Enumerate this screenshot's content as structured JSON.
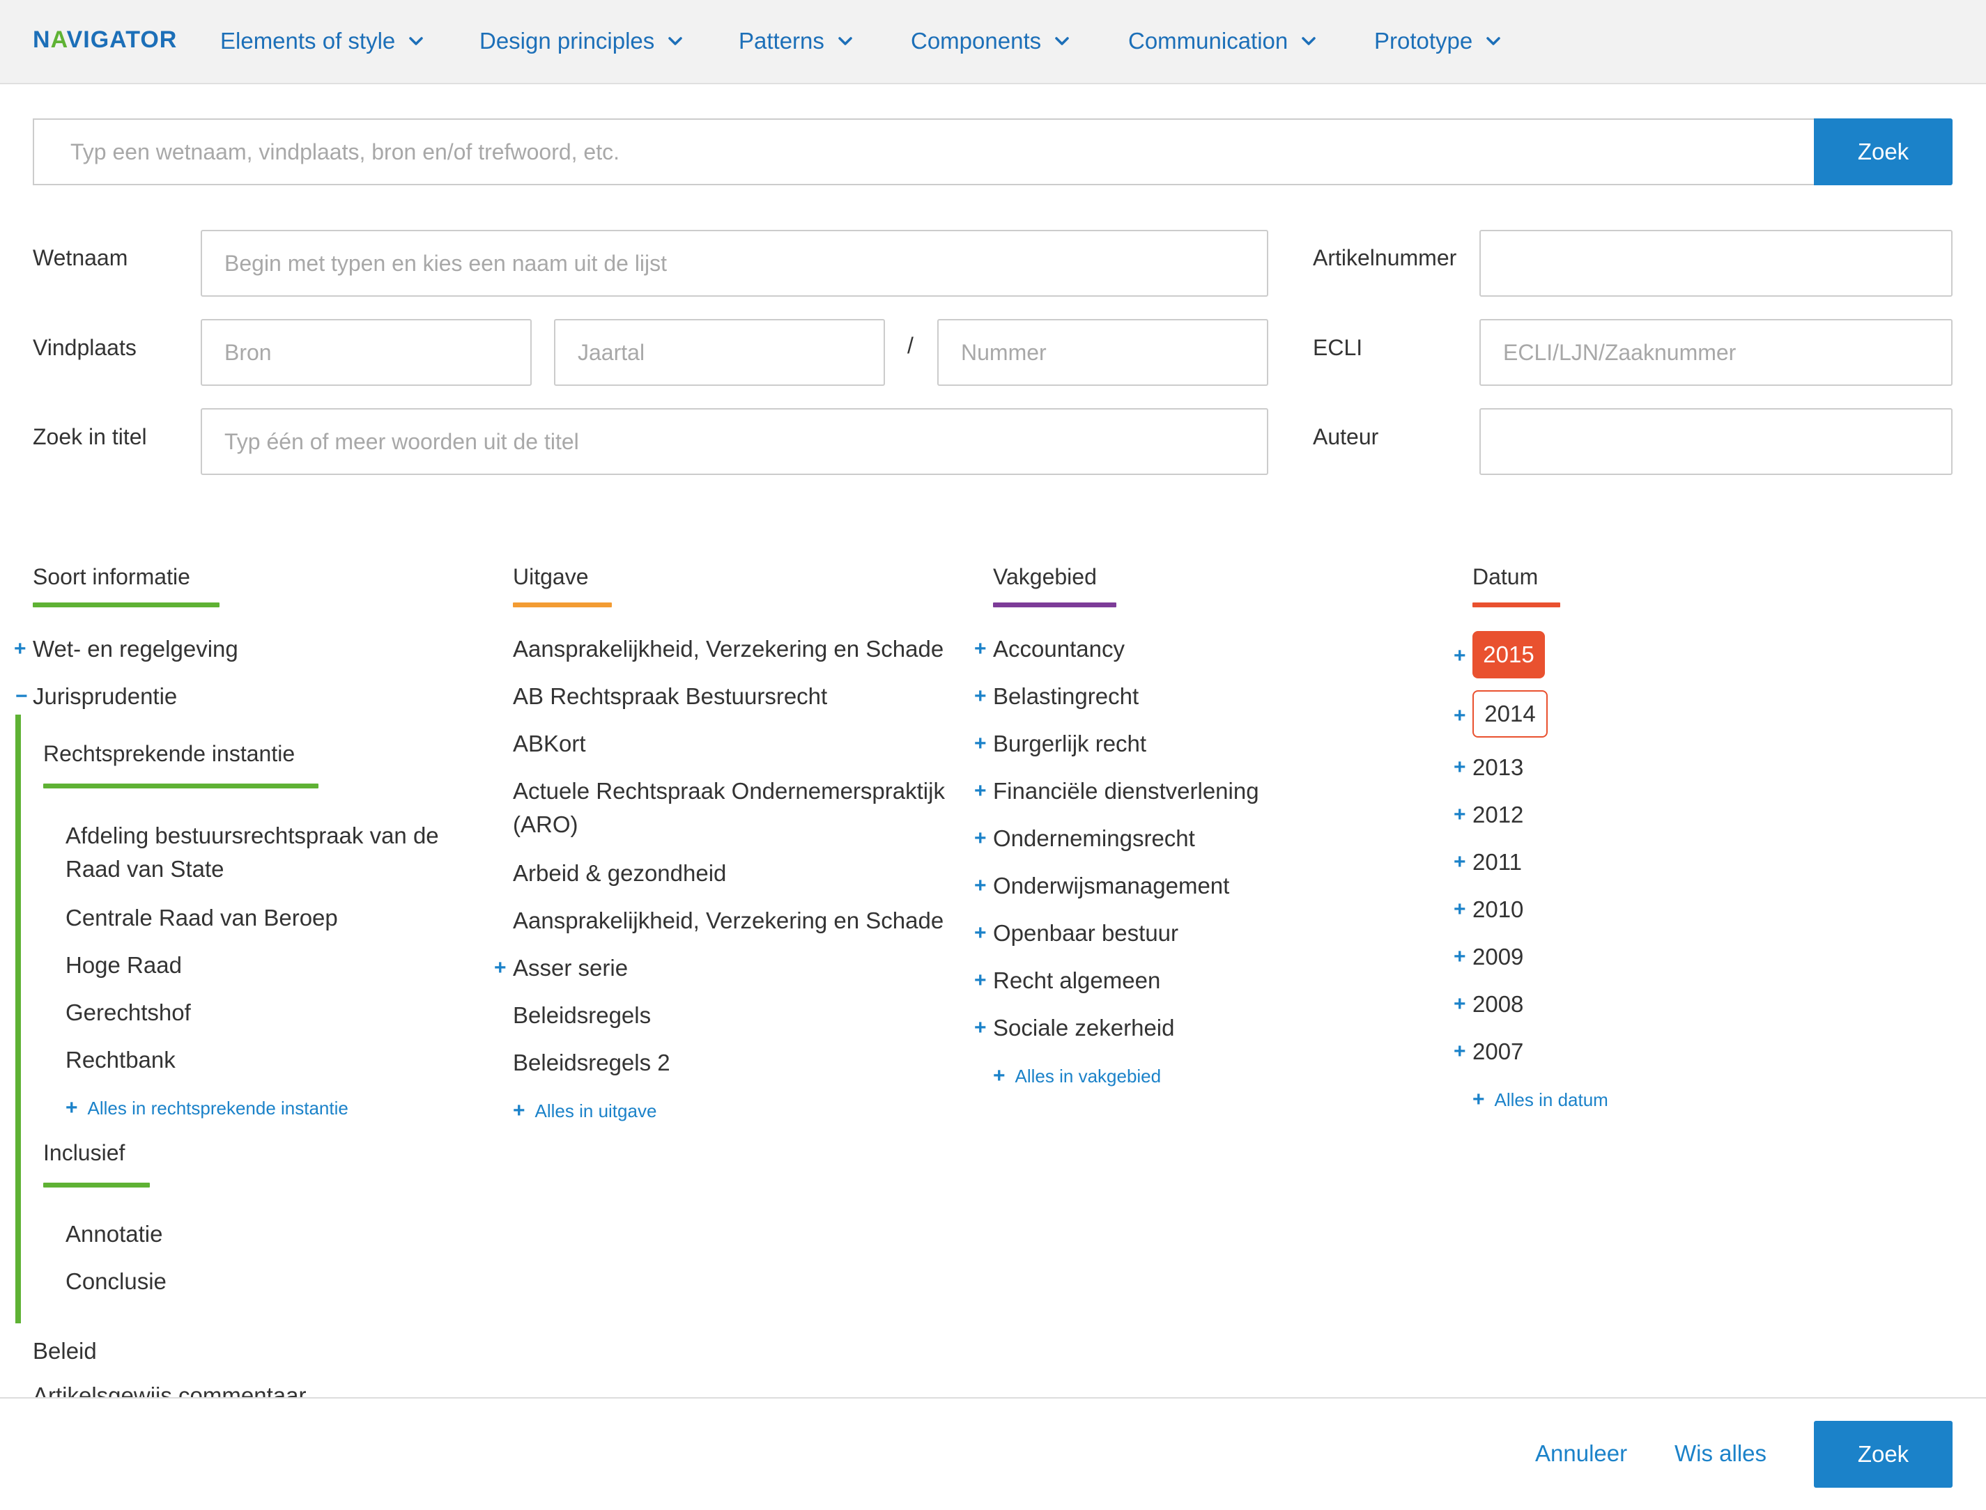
{
  "nav": {
    "logo": "NAVIGATOR",
    "items": [
      {
        "label": "Elements of style"
      },
      {
        "label": "Design principles"
      },
      {
        "label": "Patterns"
      },
      {
        "label": "Components"
      },
      {
        "label": "Communication"
      },
      {
        "label": "Prototype"
      }
    ]
  },
  "search": {
    "placeholder": "Typ een wetnaam, vindplaats, bron en/of trefwoord, etc.",
    "value": "",
    "button_label": "Zoek"
  },
  "form": {
    "wetnaam": {
      "label": "Wetnaam",
      "placeholder": "Begin met typen en kies een naam uit de lijst",
      "value": ""
    },
    "vindplaats": {
      "label": "Vindplaats",
      "bron_placeholder": "Bron",
      "jaartal_placeholder": "Jaartal",
      "separator": "/",
      "nummer_placeholder": "Nummer"
    },
    "titel": {
      "label": "Zoek in titel",
      "placeholder": "Typ één of meer woorden uit de titel",
      "value": ""
    },
    "artikelnummer": {
      "label": "Artikelnummer",
      "value": ""
    },
    "ecli": {
      "label": "ECLI",
      "placeholder": "ECLI/LJN/Zaaknummer",
      "value": ""
    },
    "auteur": {
      "label": "Auteur",
      "value": ""
    }
  },
  "filters": {
    "soort": {
      "title": "Soort informatie",
      "color": "#5fb234",
      "items": [
        {
          "label": "Wet- en regelgeving",
          "toggle": "+"
        },
        {
          "label": "Jurisprudentie",
          "toggle": "−"
        }
      ],
      "subgroups": [
        {
          "title": "Rechtsprekende instantie",
          "items": [
            "Afdeling bestuursrechtspraak van de Raad van State",
            "Centrale Raad van Beroep",
            "Hoge Raad",
            "Gerechtshof",
            "Rechtbank"
          ],
          "more": "Alles in rechtsprekende instantie"
        },
        {
          "title": "Inclusief",
          "items": [
            "Annotatie",
            "Conclusie"
          ]
        }
      ],
      "after": [
        "Beleid",
        "Artikelsgewijs commentaar"
      ]
    },
    "uitgave": {
      "title": "Uitgave",
      "color": "#f39c33",
      "items": [
        "Aansprakelijkheid, Verzekering en Schade",
        "AB Rechtspraak Bestuursrecht",
        "ABKort",
        "Actuele Rechtspraak Ondernemerspraktijk (ARO)",
        "Arbeid & gezondheid",
        "Aansprakelijkheid, Verzekering en Schade",
        "Asser serie",
        "Beleidsregels",
        "Beleidsregels 2"
      ],
      "more": "Alles in uitgave"
    },
    "vakgebied": {
      "title": "Vakgebied",
      "color": "#7d3c98",
      "items": [
        "Accountancy",
        "Belastingrecht",
        "Burgerlijk recht",
        "Financiële dienstverlening",
        "Ondernemingsrecht",
        "Onderwijsmanagement",
        "Openbaar bestuur",
        "Recht algemeen",
        "Sociale zekerheid"
      ],
      "more": "Alles in vakgebied"
    },
    "datum": {
      "title": "Datum",
      "color": "#e9512f",
      "years": [
        "2015",
        "2014",
        "2013",
        "2012",
        "2011",
        "2010",
        "2009",
        "2008",
        "2007"
      ],
      "selected": "2015",
      "highlighted": "2014",
      "more": "Alles in datum"
    }
  },
  "footer": {
    "cancel_label": "Annuleer",
    "clear_label": "Wis alles",
    "submit_label": "Zoek"
  },
  "colors": {
    "primary": "#1b82c9",
    "nav_link": "#1c6fb8",
    "green": "#5fb234",
    "orange": "#f39c33",
    "purple": "#7d3c98",
    "red": "#e9512f"
  }
}
